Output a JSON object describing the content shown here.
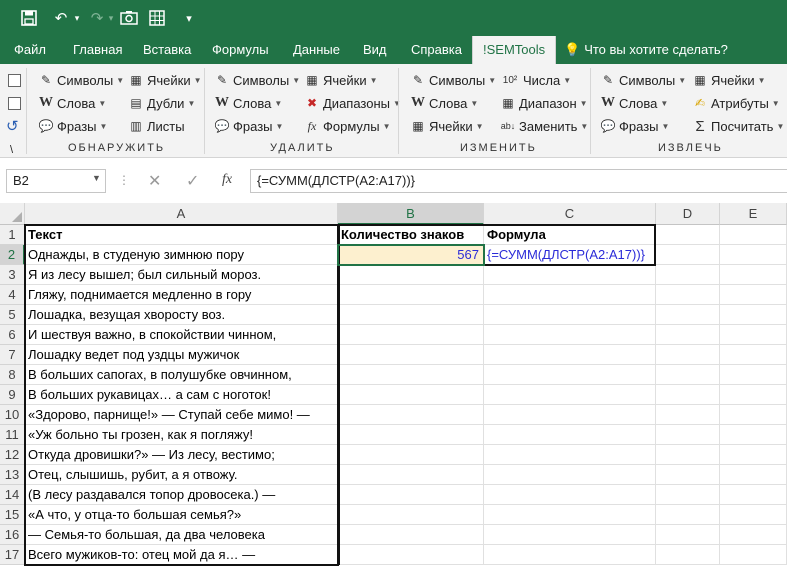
{
  "quick_access": {
    "save_icon": "save-icon",
    "undo_icon": "undo-icon",
    "redo_icon": "redo-icon",
    "camera_icon": "camera-icon",
    "grid_icon": "grid-icon",
    "customize_icon": "customize-qat-icon"
  },
  "tabs": [
    "Файл",
    "Главная",
    "Вставка",
    "Формулы",
    "Данные",
    "Вид",
    "Справка",
    "!SEMTools"
  ],
  "active_tab": "!SEMTools",
  "tell_me": "Что вы хотите сделать?",
  "ribbon": {
    "groups": [
      {
        "label": "ОБНАРУЖИТЬ",
        "items": [
          {
            "label": "Символы",
            "icon": "symbols-icon"
          },
          {
            "label": "Слова",
            "icon": "words-icon"
          },
          {
            "label": "Фразы",
            "icon": "phrases-icon"
          },
          {
            "label": "Ячейки",
            "icon": "cells-icon"
          },
          {
            "label": "Дубли",
            "icon": "duplicates-icon"
          },
          {
            "label": "Листы",
            "icon": "sheets-icon"
          }
        ]
      },
      {
        "label": "УДАЛИТЬ",
        "items": [
          {
            "label": "Символы",
            "icon": "symbols-icon"
          },
          {
            "label": "Слова",
            "icon": "words-icon"
          },
          {
            "label": "Фразы",
            "icon": "phrases-icon"
          },
          {
            "label": "Ячейки",
            "icon": "cells-icon"
          },
          {
            "label": "Диапазоны",
            "icon": "ranges-delete-icon"
          },
          {
            "label": "Формулы",
            "icon": "formulas-icon"
          }
        ]
      },
      {
        "label": "ИЗМЕНИТЬ",
        "items": [
          {
            "label": "Символы",
            "icon": "symbols-icon"
          },
          {
            "label": "Слова",
            "icon": "words-icon"
          },
          {
            "label": "Ячейки",
            "icon": "cells-icon"
          },
          {
            "label": "Числа",
            "icon": "numbers-icon"
          },
          {
            "label": "Диапазон",
            "icon": "range-icon"
          },
          {
            "label": "Заменить",
            "icon": "replace-icon"
          }
        ]
      },
      {
        "label": "ИЗВЛЕЧЬ",
        "items": [
          {
            "label": "Символы",
            "icon": "symbols-icon"
          },
          {
            "label": "Слова",
            "icon": "words-icon"
          },
          {
            "label": "Фразы",
            "icon": "phrases-icon"
          },
          {
            "label": "Ячейки",
            "icon": "cells-icon"
          },
          {
            "label": "Атрибуты",
            "icon": "attributes-icon"
          },
          {
            "label": "Посчитать",
            "icon": "sum-icon"
          }
        ]
      }
    ]
  },
  "formula_bar": {
    "name_box": "B2",
    "formula": "{=СУММ(ДЛСТР(A2:A17))}",
    "cancel_icon": "cancel-icon",
    "confirm_icon": "confirm-icon",
    "fx_icon": "fx-icon"
  },
  "columns": [
    "A",
    "B",
    "C",
    "D",
    "E"
  ],
  "rows": [
    "1",
    "2",
    "3",
    "4",
    "5",
    "6",
    "7",
    "8",
    "9",
    "10",
    "11",
    "12",
    "13",
    "14",
    "15",
    "16",
    "17"
  ],
  "cells": {
    "A": [
      "Текст",
      "Однажды, в студеную зимнюю пору",
      "Я из лесу вышел; был сильный мороз.",
      "Гляжу, поднимается медленно в гору",
      "Лошадка, везущая хворосту воз.",
      "И шествуя важно, в спокойствии чинном,",
      "Лошадку ведет под уздцы мужичок",
      "В больших сапогах, в полушубке овчинном,",
      "В больших рукавицах… а сам с ноготок!",
      "«Здорово, парнище!» — Ступай себе мимо! —",
      "«Уж больно ты грозен, как я погляжу!",
      "Откуда дровишки?» — Из лесу, вестимо;",
      "Отец, слышишь, рубит, а я отвожу.",
      "(В лесу раздавался топор дровосека.) —",
      "«А что, у отца-то большая семья?»",
      "— Семья-то большая, да два человека",
      "Всего мужиков-то: отец мой да я… —"
    ],
    "B1": "Количество знаков",
    "B2": "567",
    "C1": "Формула",
    "C2": "{=СУММ(ДЛСТР(A2:A17))}"
  },
  "colors": {
    "excel_green": "#217346",
    "result_fill": "#fdf0cf",
    "formula_text": "#2b2bd8"
  }
}
